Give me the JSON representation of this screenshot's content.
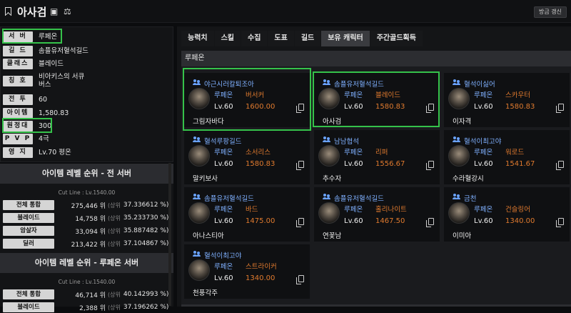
{
  "header": {
    "title": "아사검",
    "refresh_label": "방금 갱신"
  },
  "profile": {
    "rows": [
      {
        "label": "서 버",
        "value": "루페온"
      },
      {
        "label": "길 드",
        "value": "솜플유저혈석길드"
      },
      {
        "label": "클래스",
        "value": "블레이드"
      },
      {
        "label": "칭 호",
        "value": "비아키스의 서큐\n버스"
      },
      {
        "label": "전 투",
        "value": "60"
      },
      {
        "label": "아이템",
        "value": "1,580.83"
      },
      {
        "label": "원정대",
        "value": "300"
      },
      {
        "label": "P V P",
        "value": "4극"
      },
      {
        "label": "영 지",
        "value": "Lv.70 평온"
      }
    ]
  },
  "rank_all": {
    "title": "아이템 레벨 순위 - 전 서버",
    "cutline": "Cut Line : Lv.1540.00",
    "rows": [
      {
        "label": "전체 통합",
        "rank": "275,446 위",
        "unit": "(상위",
        "pct": "37.336612 %)"
      },
      {
        "label": "블레이드",
        "rank": "14,758 위",
        "unit": "(상위",
        "pct": "35.233730 %)"
      },
      {
        "label": "암살자",
        "rank": "33,094 위",
        "unit": "(상위",
        "pct": "35.887482 %)"
      },
      {
        "label": "딜러",
        "rank": "213,422 위",
        "unit": "(상위",
        "pct": "37.104867 %)"
      }
    ]
  },
  "rank_server": {
    "title": "아이템 레벨 순위 - 루페온 서버",
    "cutline": "Cut Line : Lv.1540.00",
    "rows": [
      {
        "label": "전체 통합",
        "rank": "46,714 위",
        "unit": "(상위",
        "pct": "40.142993 %)"
      },
      {
        "label": "블레이드",
        "rank": "2,388 위",
        "unit": "(상위",
        "pct": "37.196262 %)"
      }
    ]
  },
  "tabs": [
    "능력치",
    "스킬",
    "수집",
    "도표",
    "길드",
    "보유 캐릭터",
    "주간골드획득"
  ],
  "server_header": "루페온",
  "characters": [
    {
      "guild": "야근시러칼퇴조아",
      "server": "루페온",
      "class": "버서커",
      "level": "Lv.60",
      "ilvl": "1600.00",
      "name": "그림자바다"
    },
    {
      "guild": "솜플유저혈석길드",
      "server": "루페온",
      "class": "블레이드",
      "level": "Lv.60",
      "ilvl": "1580.83",
      "name": "아사검"
    },
    {
      "guild": "혈석이싫어",
      "server": "루페온",
      "class": "스카우터",
      "level": "Lv.60",
      "ilvl": "1580.83",
      "name": "이자격"
    },
    {
      "guild": "혈석루팡길드",
      "server": "루페온",
      "class": "소서리스",
      "level": "Lv.60",
      "ilvl": "1580.83",
      "name": "말키보사"
    },
    {
      "guild": "남남협석",
      "server": "루페온",
      "class": "리퍼",
      "level": "Lv.60",
      "ilvl": "1556.67",
      "name": "추수자"
    },
    {
      "guild": "혈석이최고야",
      "server": "루페온",
      "class": "워로드",
      "level": "Lv.60",
      "ilvl": "1541.67",
      "name": "수라혈강시"
    },
    {
      "guild": "솜플유저혈석길드",
      "server": "루페온",
      "class": "바드",
      "level": "Lv.60",
      "ilvl": "1475.00",
      "name": "아나스티아"
    },
    {
      "guild": "솜플유저혈석길드",
      "server": "루페온",
      "class": "홀리나이트",
      "level": "Lv.60",
      "ilvl": "1467.50",
      "name": "연꽃남"
    },
    {
      "guild": "금천",
      "server": "루페온",
      "class": "건슬링어",
      "level": "Lv.60",
      "ilvl": "1340.00",
      "name": "이미아"
    },
    {
      "guild": "혈석이최고야",
      "server": "루페온",
      "class": "스트라이커",
      "level": "Lv.60",
      "ilvl": "1340.00",
      "name": "천풍각주"
    }
  ],
  "colors": {
    "highlight": "#35c24a",
    "guild": "#7fb0ff",
    "orange": "#e07a2e"
  }
}
